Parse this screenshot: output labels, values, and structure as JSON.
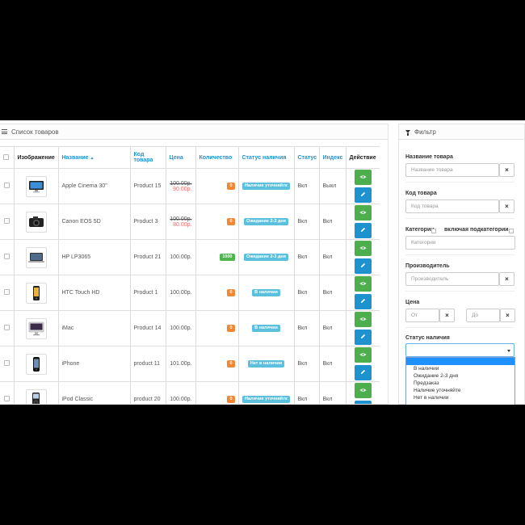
{
  "list_panel": {
    "title": "Список товаров",
    "columns": {
      "image": "Изображение",
      "name": "Название",
      "code": "Код товара",
      "price": "Цена",
      "quantity": "Количество",
      "availability": "Статус наличия",
      "status": "Статус",
      "index": "Индекс",
      "action": "Действие"
    },
    "rows": [
      {
        "name": "Apple Cinema 30\"",
        "code": "Product 15",
        "price_old": "100.00р.",
        "price": "90.00р.",
        "quantity": "0",
        "quantity_color": "#f38733",
        "availability": "Наличие уточняйте",
        "status": "Вкл",
        "index": "Выкл",
        "image_icon": "monitor-icon"
      },
      {
        "name": "Canon EOS 5D",
        "code": "Product 3",
        "price_old": "100.00р.",
        "price": "80.00р.",
        "quantity": "0",
        "quantity_color": "#f38733",
        "availability": "Ожидание 2-3 дня",
        "status": "Вкл",
        "index": "Вкл",
        "image_icon": "camera-icon"
      },
      {
        "name": "HP LP3065",
        "code": "Product 21",
        "price_old": "",
        "price": "100.00р.",
        "quantity": "1000",
        "quantity_color": "#4cb64c",
        "availability": "Ожидание 2-3 дня",
        "status": "Вкл",
        "index": "Вкл",
        "image_icon": "laptop-icon"
      },
      {
        "name": "HTC Touch HD",
        "code": "Product 1",
        "price_old": "",
        "price": "100.00р.",
        "quantity": "0",
        "quantity_color": "#f38733",
        "availability": "В наличии",
        "status": "Вкл",
        "index": "Вкл",
        "image_icon": "phone-icon"
      },
      {
        "name": "iMac",
        "code": "Product 14",
        "price_old": "",
        "price": "100.00р.",
        "quantity": "0",
        "quantity_color": "#f38733",
        "availability": "В наличии",
        "status": "Вкл",
        "index": "Вкл",
        "image_icon": "imac-icon"
      },
      {
        "name": "iPhone",
        "code": "product 11",
        "price_old": "",
        "price": "101.00р.",
        "quantity": "0",
        "quantity_color": "#f38733",
        "availability": "Нет в наличии",
        "status": "Вкл",
        "index": "Вкл",
        "image_icon": "iphone-icon"
      },
      {
        "name": "iPod Classic",
        "code": "product 20",
        "price_old": "",
        "price": "100.00р.",
        "quantity": "0",
        "quantity_color": "#f38733",
        "availability": "Наличие уточняйте",
        "status": "Вкл",
        "index": "Вкл",
        "image_icon": "ipod-icon"
      }
    ]
  },
  "filter_panel": {
    "title": "Фильтр",
    "name_label": "Название товара",
    "name_placeholder": "Название товара",
    "code_label": "Код товара",
    "code_placeholder": "Код товара",
    "category_label": "Категории",
    "subcategory_label": "включая подкатегории",
    "category_placeholder": "Категории",
    "manufacturer_label": "Производитель",
    "manufacturer_placeholder": "Производитель",
    "price_label": "Цена",
    "price_from_placeholder": "От",
    "price_to_placeholder": "До",
    "availability_label": "Статус наличия",
    "availability_options": [
      "В наличии",
      "Ожидание 2-3 дня",
      "Предзаказ",
      "Наличие уточняйте",
      "Нет в наличии"
    ],
    "clear_symbol": "×"
  },
  "colors": {
    "link": "#1e91cf",
    "view_button": "#4cae4c",
    "edit_button": "#1e91cf",
    "sale_price": "#f56b6b",
    "availability_label": "#5bc0de",
    "dropdown_selected": "#1e90ff"
  }
}
